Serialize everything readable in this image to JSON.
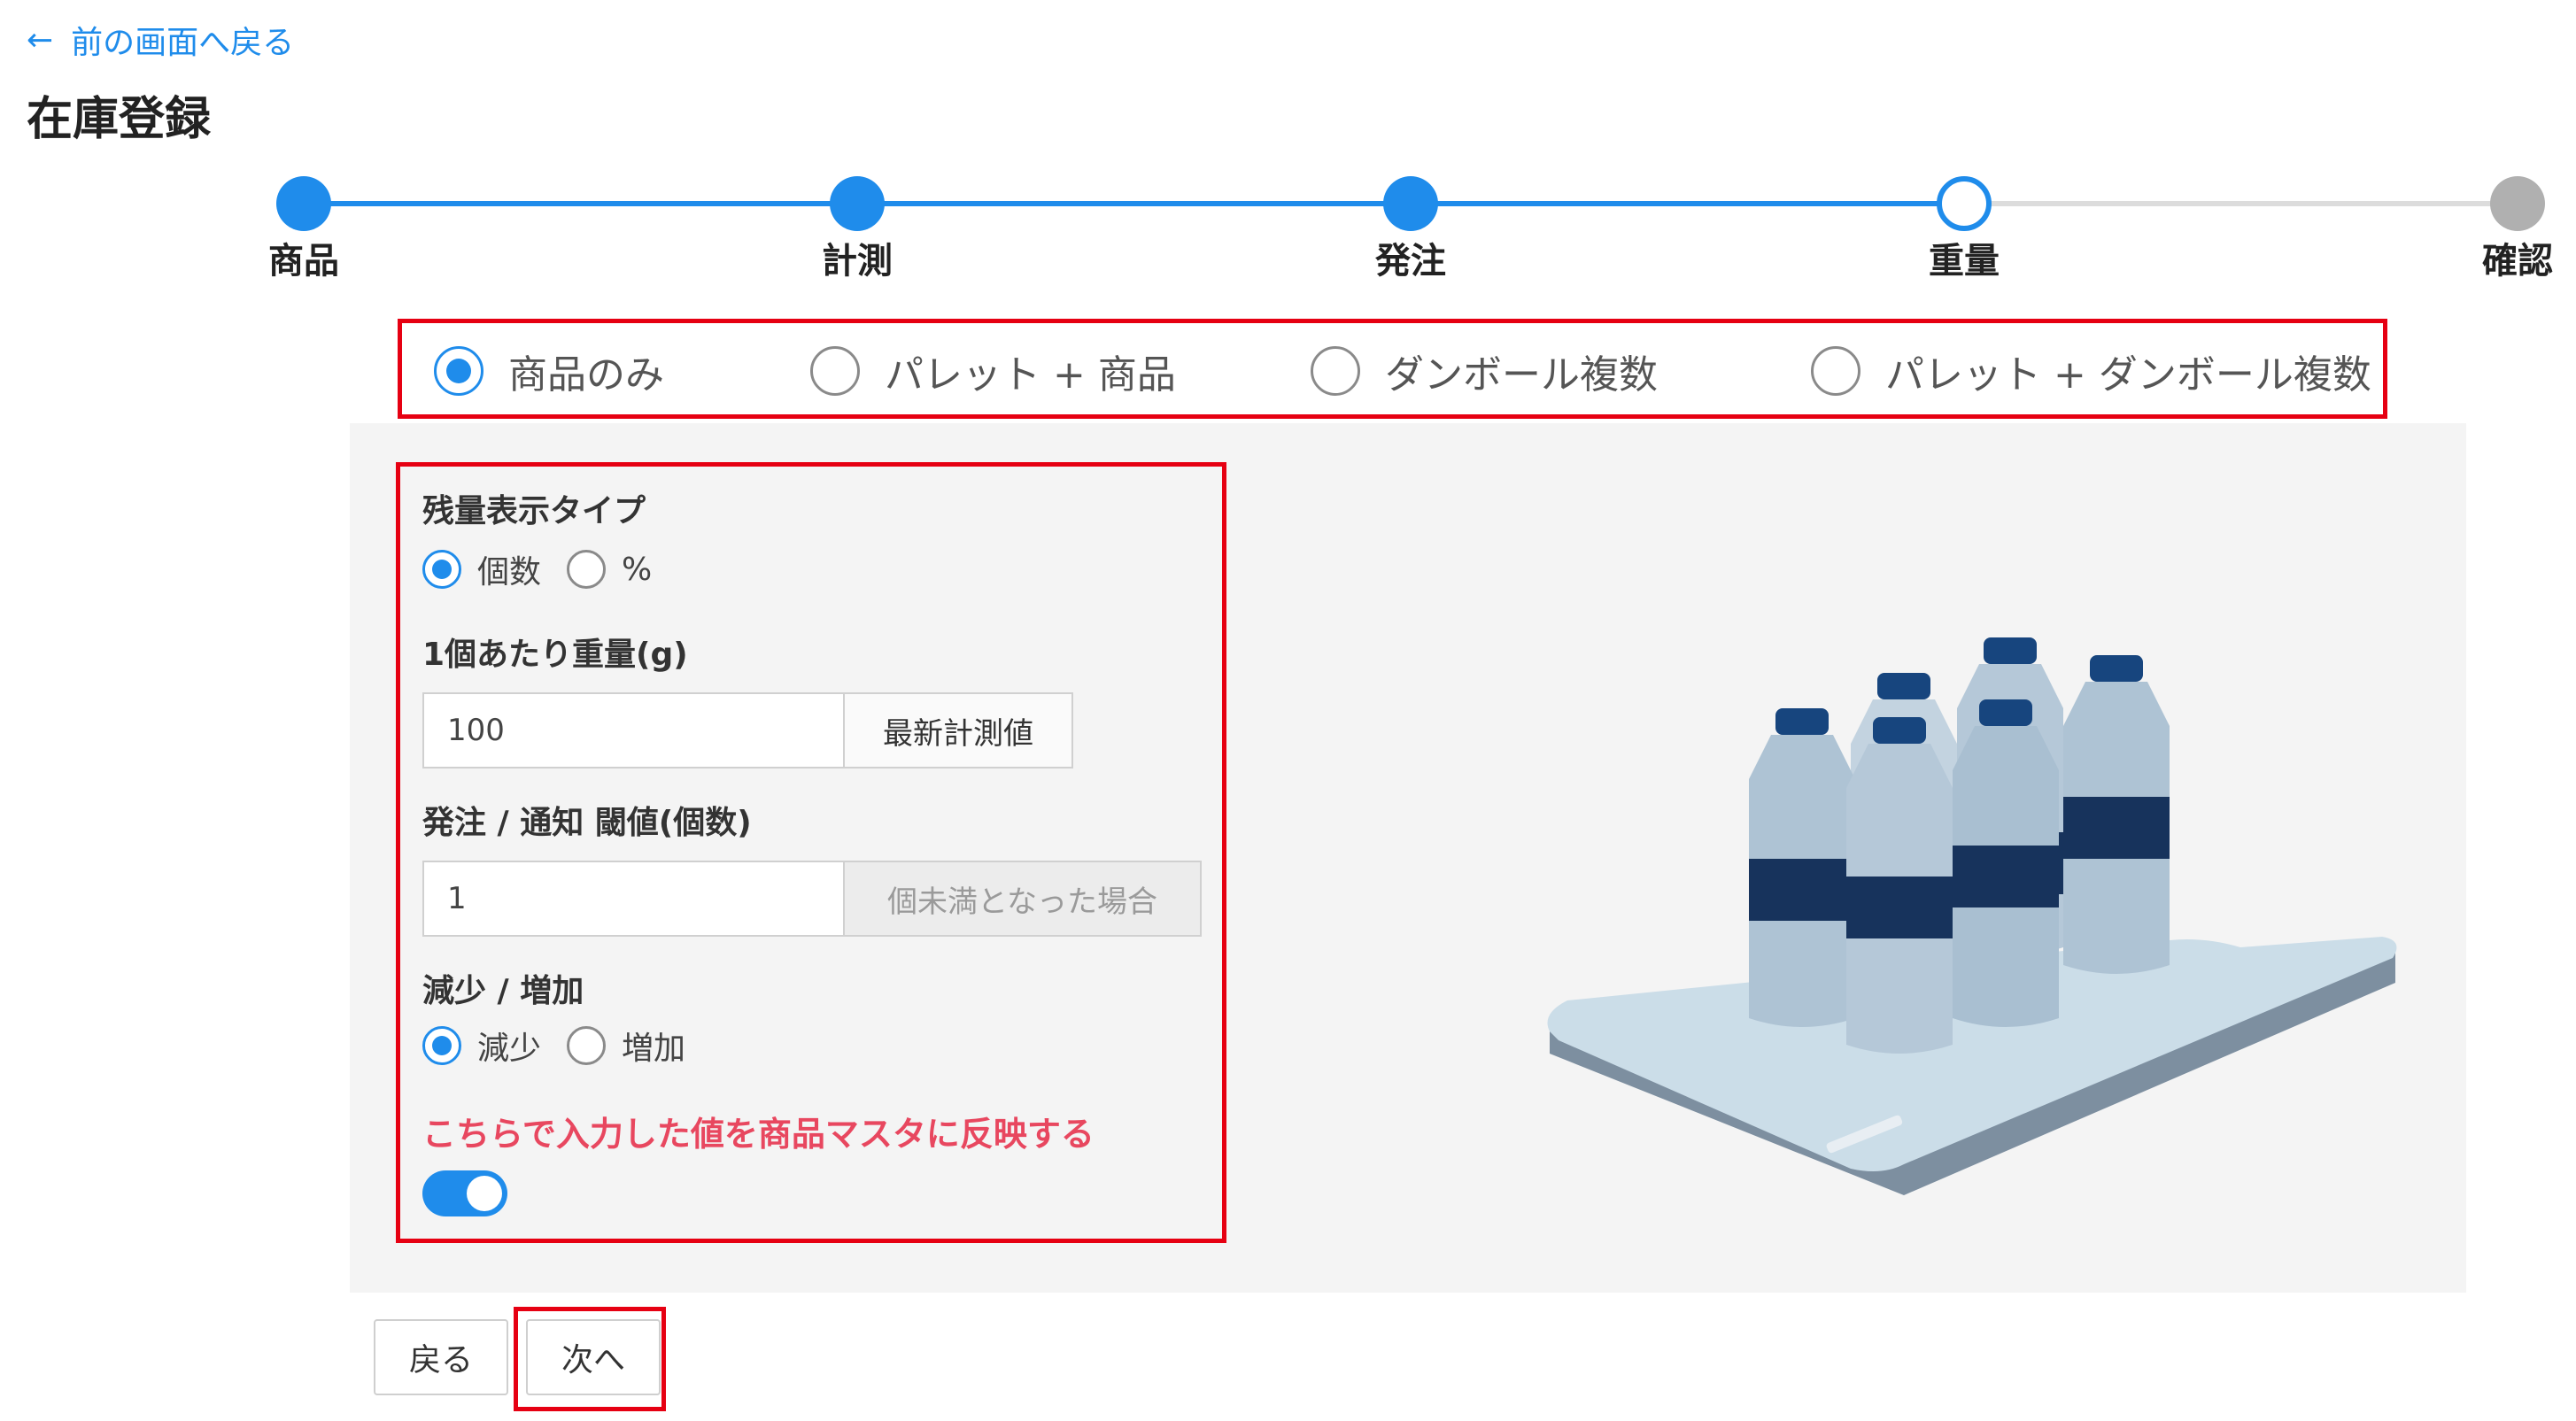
{
  "nav": {
    "back_label": "前の画面へ戻る"
  },
  "page": {
    "title": "在庫登録"
  },
  "stepper": {
    "steps": [
      {
        "label": "商品",
        "state": "done"
      },
      {
        "label": "計測",
        "state": "done"
      },
      {
        "label": "発注",
        "state": "done"
      },
      {
        "label": "重量",
        "state": "current"
      },
      {
        "label": "確認",
        "state": "todo"
      }
    ]
  },
  "mode": {
    "options": [
      {
        "label": "商品のみ",
        "selected": true
      },
      {
        "label": "パレット + 商品",
        "selected": false
      },
      {
        "label": "ダンボール複数",
        "selected": false
      },
      {
        "label": "パレット + ダンボール複数",
        "selected": false
      }
    ]
  },
  "form": {
    "display_type": {
      "label": "残量表示タイプ",
      "options": [
        {
          "label": "個数",
          "selected": true
        },
        {
          "label": "%",
          "selected": false
        }
      ]
    },
    "unit_weight": {
      "label": "1個あたり重量(g)",
      "value": "100",
      "button_label": "最新計測値"
    },
    "threshold": {
      "label": "発注 / 通知 閾値(個数)",
      "value": "1",
      "suffix": "個未満となった場合"
    },
    "direction": {
      "label": "減少 / 増加",
      "options": [
        {
          "label": "減少",
          "selected": true
        },
        {
          "label": "増加",
          "selected": false
        }
      ]
    },
    "reflect": {
      "label": "こちらで入力した値を商品マスタに反映する",
      "enabled": true
    }
  },
  "footer": {
    "back_label": "戻る",
    "next_label": "次へ"
  },
  "colors": {
    "accent": "#1f8ceb",
    "annotation": "#e60012",
    "warning_text": "#e8475f",
    "panel_bg": "#f4f4f4"
  }
}
